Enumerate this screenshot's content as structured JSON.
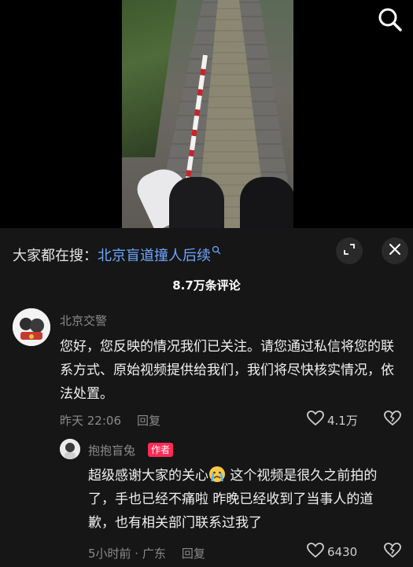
{
  "search_bar": {
    "prefix": "大家都在搜：",
    "query": "北京盲道撞人后续"
  },
  "comments_count_label": "8.7万条评论",
  "comments": [
    {
      "author": "北京交警",
      "text": "您好，您反映的情况我们已关注。请您通过私信将您的联系方式、原始视频提供给我们，我们将尽快核实情况，依法处置。",
      "time": "昨天 22:06",
      "reply_label": "回复",
      "likes": "4.1万"
    }
  ],
  "reply": {
    "author": "抱抱盲兔",
    "badge": "作者",
    "text_part1": "超级感谢大家的关心",
    "text_part2": " 这个视频是很久之前拍的了，手也已经不痛啦 昨晚已经收到了当事人的道歉，也有相关部门联系过我了",
    "time_location": "5小时前 · 广东",
    "reply_label": "回复",
    "likes": "6430"
  },
  "colors": {
    "accent_link": "#6ea6ff",
    "author_badge": "#fe2c55",
    "sheet_bg": "#161616"
  }
}
